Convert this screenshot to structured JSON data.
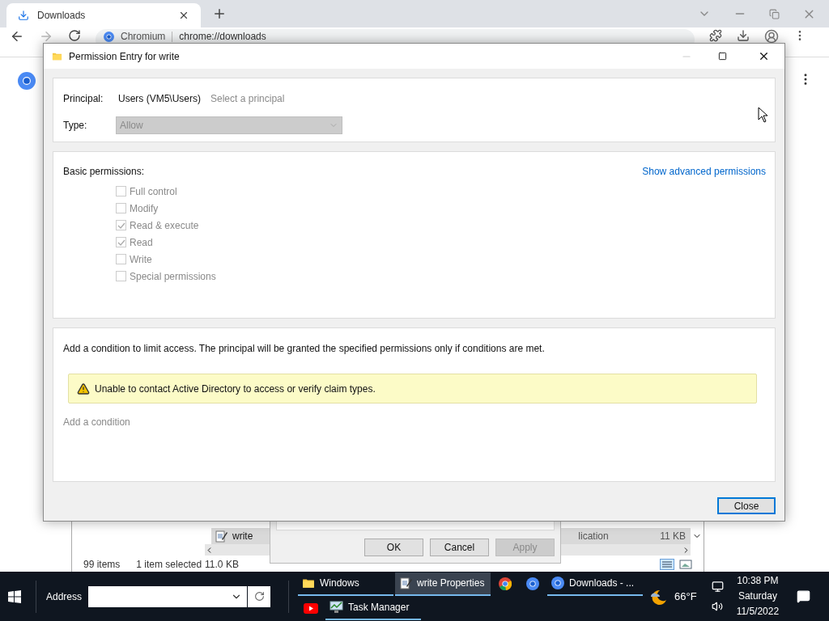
{
  "browser": {
    "tab": {
      "title": "Downloads"
    },
    "address": {
      "site": "Chromium",
      "url": "chrome://downloads"
    }
  },
  "dialog": {
    "title": "Permission Entry for write",
    "principal": {
      "label": "Principal:",
      "value": "Users (VM5\\Users)",
      "link": "Select a principal"
    },
    "type": {
      "label": "Type:",
      "value": "Allow",
      "disabled": true
    },
    "permissions": {
      "label": "Basic permissions:",
      "advanced_link": "Show advanced permissions",
      "items": [
        {
          "label": "Full control",
          "checked": false,
          "disabled": true
        },
        {
          "label": "Modify",
          "checked": false,
          "disabled": true
        },
        {
          "label": "Read & execute",
          "checked": true,
          "disabled": true
        },
        {
          "label": "Read",
          "checked": true,
          "disabled": true
        },
        {
          "label": "Write",
          "checked": false,
          "disabled": true
        },
        {
          "label": "Special permissions",
          "checked": false,
          "disabled": true
        }
      ]
    },
    "condition": {
      "text": "Add a condition to limit access. The principal will be granted the specified permissions only if conditions are met.",
      "warning": "Unable to contact Active Directory to access or verify claim types.",
      "add_link": "Add a condition"
    },
    "buttons": [
      "Close"
    ]
  },
  "explorer": {
    "row": {
      "name": "write",
      "type": "lication",
      "size": "11 KB"
    },
    "status": [
      "99 items",
      "1 item selected",
      "11.0 KB"
    ]
  },
  "properties": {
    "buttons": [
      {
        "label": "OK",
        "disabled": false
      },
      {
        "label": "Cancel",
        "disabled": false
      },
      {
        "label": "Apply",
        "disabled": true
      }
    ]
  },
  "taskbar": {
    "address_label": "Address",
    "rows": [
      [
        {
          "kind": "labeled",
          "label": "Windows",
          "selected": false
        },
        {
          "kind": "labeled",
          "label": "write Properties",
          "selected": true
        },
        {
          "kind": "icon"
        },
        {
          "kind": "icon"
        },
        {
          "kind": "labeled",
          "label": "Downloads - ...",
          "selected": false
        }
      ],
      [
        {
          "kind": "icon"
        },
        {
          "kind": "labeled",
          "label": "Task Manager",
          "selected": false
        }
      ]
    ],
    "weather": "66°F",
    "time": "10:38 PM",
    "day": "Saturday",
    "date": "11/5/2022"
  }
}
